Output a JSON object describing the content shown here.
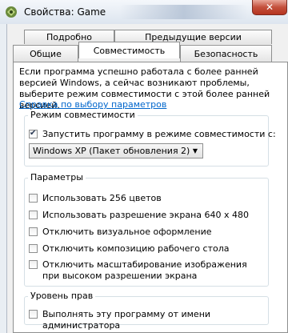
{
  "window": {
    "title": "Свойства: Game",
    "close_glyph": "✕"
  },
  "tabs_back": [
    "Подробно",
    "Предыдущие версии"
  ],
  "tabs_front": [
    "Общие",
    "Совместимость",
    "Безопасность"
  ],
  "intro_text": "Если программа успешно работала с более ранней версией Windows, а сейчас возникают проблемы, выберите режим совместимости с этой более ранней версией.",
  "help_link": "Справка по выбору параметров",
  "compat_group": {
    "legend": "Режим совместимости",
    "run_compat_label": "Запустить программу в режиме совместимости с:",
    "run_compat_checked": true,
    "selected_os": "Windows XP (Пакет обновления 2)"
  },
  "params_group": {
    "legend": "Параметры",
    "options": [
      {
        "label": "Использовать 256 цветов",
        "checked": false
      },
      {
        "label": "Использовать разрешение экрана 640 х 480",
        "checked": false
      },
      {
        "label": "Отключить визуальное оформление",
        "checked": false
      },
      {
        "label": "Отключить композицию рабочего стола",
        "checked": false
      },
      {
        "label": "Отключить масштабирование изображения при высоком разрешении экрана",
        "checked": false
      }
    ]
  },
  "rights_group": {
    "legend": "Уровень прав",
    "run_as_admin_label": "Выполнять эту программу от имени администратора",
    "run_as_admin_checked": false
  },
  "colors": {
    "link": "#0066cc",
    "close": "#c4503c"
  }
}
